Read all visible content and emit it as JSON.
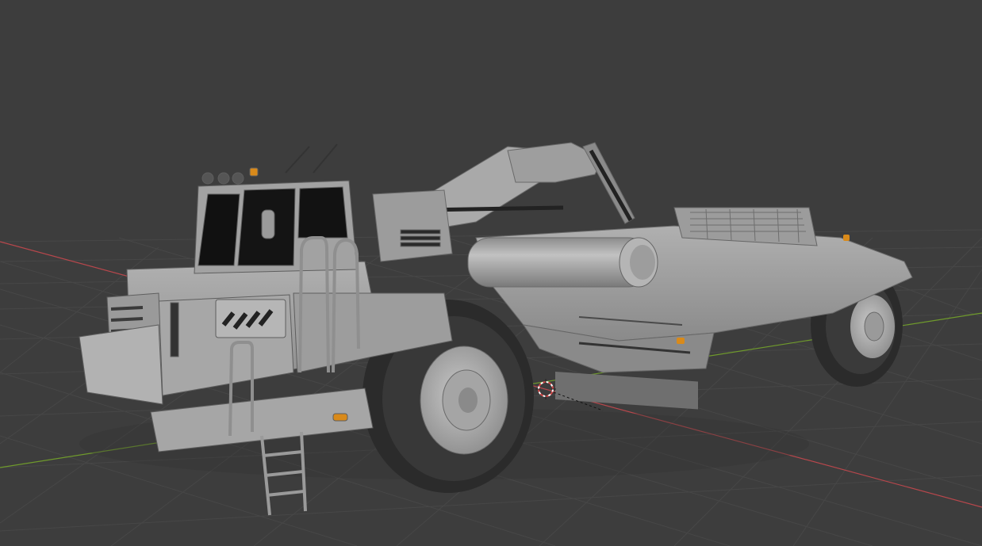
{
  "viewport": {
    "background": "#3d3d3d",
    "grid_color": "#4a4a4a",
    "axis_x_color": "#b8474c",
    "axis_y_color": "#6f9a2c",
    "cursor_name": "3d-cursor"
  },
  "model": {
    "name": "wheel-tractor-scraper",
    "shade_light": "#a8a8a8",
    "shade_mid": "#8c8c8c",
    "shade_dark": "#6a6a6a",
    "tire_color": "#2b2b2b",
    "beacon_color": "#d98a1a"
  }
}
